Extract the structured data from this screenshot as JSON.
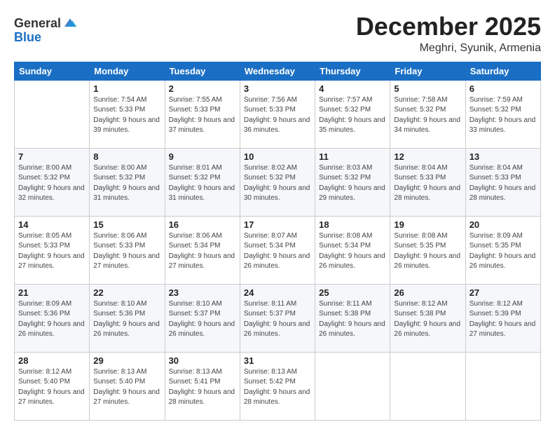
{
  "header": {
    "logo_general": "General",
    "logo_blue": "Blue",
    "title": "December 2025",
    "subtitle": "Meghri, Syunik, Armenia"
  },
  "calendar": {
    "days_of_week": [
      "Sunday",
      "Monday",
      "Tuesday",
      "Wednesday",
      "Thursday",
      "Friday",
      "Saturday"
    ],
    "weeks": [
      [
        {
          "day": "",
          "sunrise": "",
          "sunset": "",
          "daylight": ""
        },
        {
          "day": "1",
          "sunrise": "Sunrise: 7:54 AM",
          "sunset": "Sunset: 5:33 PM",
          "daylight": "Daylight: 9 hours and 39 minutes."
        },
        {
          "day": "2",
          "sunrise": "Sunrise: 7:55 AM",
          "sunset": "Sunset: 5:33 PM",
          "daylight": "Daylight: 9 hours and 37 minutes."
        },
        {
          "day": "3",
          "sunrise": "Sunrise: 7:56 AM",
          "sunset": "Sunset: 5:33 PM",
          "daylight": "Daylight: 9 hours and 36 minutes."
        },
        {
          "day": "4",
          "sunrise": "Sunrise: 7:57 AM",
          "sunset": "Sunset: 5:32 PM",
          "daylight": "Daylight: 9 hours and 35 minutes."
        },
        {
          "day": "5",
          "sunrise": "Sunrise: 7:58 AM",
          "sunset": "Sunset: 5:32 PM",
          "daylight": "Daylight: 9 hours and 34 minutes."
        },
        {
          "day": "6",
          "sunrise": "Sunrise: 7:59 AM",
          "sunset": "Sunset: 5:32 PM",
          "daylight": "Daylight: 9 hours and 33 minutes."
        }
      ],
      [
        {
          "day": "7",
          "sunrise": "Sunrise: 8:00 AM",
          "sunset": "Sunset: 5:32 PM",
          "daylight": "Daylight: 9 hours and 32 minutes."
        },
        {
          "day": "8",
          "sunrise": "Sunrise: 8:00 AM",
          "sunset": "Sunset: 5:32 PM",
          "daylight": "Daylight: 9 hours and 31 minutes."
        },
        {
          "day": "9",
          "sunrise": "Sunrise: 8:01 AM",
          "sunset": "Sunset: 5:32 PM",
          "daylight": "Daylight: 9 hours and 31 minutes."
        },
        {
          "day": "10",
          "sunrise": "Sunrise: 8:02 AM",
          "sunset": "Sunset: 5:32 PM",
          "daylight": "Daylight: 9 hours and 30 minutes."
        },
        {
          "day": "11",
          "sunrise": "Sunrise: 8:03 AM",
          "sunset": "Sunset: 5:32 PM",
          "daylight": "Daylight: 9 hours and 29 minutes."
        },
        {
          "day": "12",
          "sunrise": "Sunrise: 8:04 AM",
          "sunset": "Sunset: 5:33 PM",
          "daylight": "Daylight: 9 hours and 28 minutes."
        },
        {
          "day": "13",
          "sunrise": "Sunrise: 8:04 AM",
          "sunset": "Sunset: 5:33 PM",
          "daylight": "Daylight: 9 hours and 28 minutes."
        }
      ],
      [
        {
          "day": "14",
          "sunrise": "Sunrise: 8:05 AM",
          "sunset": "Sunset: 5:33 PM",
          "daylight": "Daylight: 9 hours and 27 minutes."
        },
        {
          "day": "15",
          "sunrise": "Sunrise: 8:06 AM",
          "sunset": "Sunset: 5:33 PM",
          "daylight": "Daylight: 9 hours and 27 minutes."
        },
        {
          "day": "16",
          "sunrise": "Sunrise: 8:06 AM",
          "sunset": "Sunset: 5:34 PM",
          "daylight": "Daylight: 9 hours and 27 minutes."
        },
        {
          "day": "17",
          "sunrise": "Sunrise: 8:07 AM",
          "sunset": "Sunset: 5:34 PM",
          "daylight": "Daylight: 9 hours and 26 minutes."
        },
        {
          "day": "18",
          "sunrise": "Sunrise: 8:08 AM",
          "sunset": "Sunset: 5:34 PM",
          "daylight": "Daylight: 9 hours and 26 minutes."
        },
        {
          "day": "19",
          "sunrise": "Sunrise: 8:08 AM",
          "sunset": "Sunset: 5:35 PM",
          "daylight": "Daylight: 9 hours and 26 minutes."
        },
        {
          "day": "20",
          "sunrise": "Sunrise: 8:09 AM",
          "sunset": "Sunset: 5:35 PM",
          "daylight": "Daylight: 9 hours and 26 minutes."
        }
      ],
      [
        {
          "day": "21",
          "sunrise": "Sunrise: 8:09 AM",
          "sunset": "Sunset: 5:36 PM",
          "daylight": "Daylight: 9 hours and 26 minutes."
        },
        {
          "day": "22",
          "sunrise": "Sunrise: 8:10 AM",
          "sunset": "Sunset: 5:36 PM",
          "daylight": "Daylight: 9 hours and 26 minutes."
        },
        {
          "day": "23",
          "sunrise": "Sunrise: 8:10 AM",
          "sunset": "Sunset: 5:37 PM",
          "daylight": "Daylight: 9 hours and 26 minutes."
        },
        {
          "day": "24",
          "sunrise": "Sunrise: 8:11 AM",
          "sunset": "Sunset: 5:37 PM",
          "daylight": "Daylight: 9 hours and 26 minutes."
        },
        {
          "day": "25",
          "sunrise": "Sunrise: 8:11 AM",
          "sunset": "Sunset: 5:38 PM",
          "daylight": "Daylight: 9 hours and 26 minutes."
        },
        {
          "day": "26",
          "sunrise": "Sunrise: 8:12 AM",
          "sunset": "Sunset: 5:38 PM",
          "daylight": "Daylight: 9 hours and 26 minutes."
        },
        {
          "day": "27",
          "sunrise": "Sunrise: 8:12 AM",
          "sunset": "Sunset: 5:39 PM",
          "daylight": "Daylight: 9 hours and 27 minutes."
        }
      ],
      [
        {
          "day": "28",
          "sunrise": "Sunrise: 8:12 AM",
          "sunset": "Sunset: 5:40 PM",
          "daylight": "Daylight: 9 hours and 27 minutes."
        },
        {
          "day": "29",
          "sunrise": "Sunrise: 8:13 AM",
          "sunset": "Sunset: 5:40 PM",
          "daylight": "Daylight: 9 hours and 27 minutes."
        },
        {
          "day": "30",
          "sunrise": "Sunrise: 8:13 AM",
          "sunset": "Sunset: 5:41 PM",
          "daylight": "Daylight: 9 hours and 28 minutes."
        },
        {
          "day": "31",
          "sunrise": "Sunrise: 8:13 AM",
          "sunset": "Sunset: 5:42 PM",
          "daylight": "Daylight: 9 hours and 28 minutes."
        },
        {
          "day": "",
          "sunrise": "",
          "sunset": "",
          "daylight": ""
        },
        {
          "day": "",
          "sunrise": "",
          "sunset": "",
          "daylight": ""
        },
        {
          "day": "",
          "sunrise": "",
          "sunset": "",
          "daylight": ""
        }
      ]
    ]
  }
}
